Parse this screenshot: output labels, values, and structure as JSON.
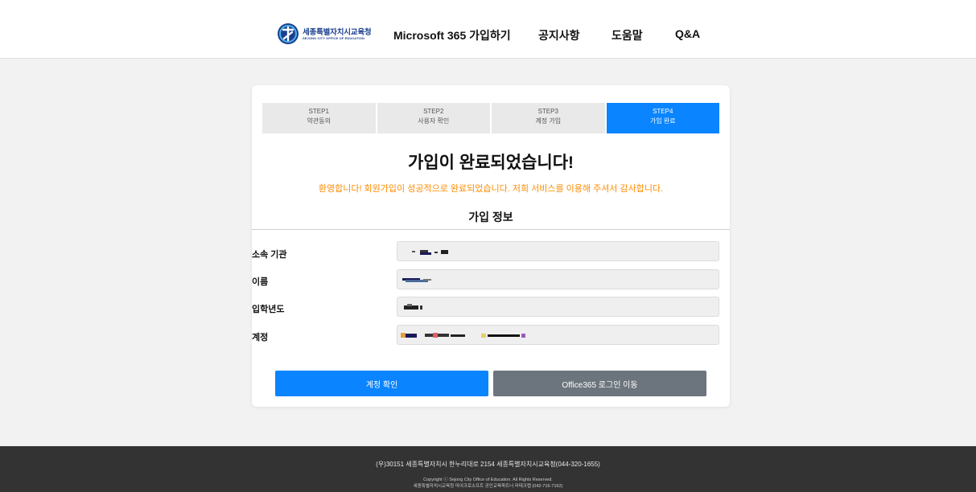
{
  "header": {
    "logo_text": "세종특별자치시교육청",
    "logo_sub": "SEJONG CITY OFFICE OF EDUCATION",
    "nav": [
      {
        "label": "Microsoft 365 가입하기"
      },
      {
        "label": "공지사항"
      },
      {
        "label": "도움말"
      },
      {
        "label": "Q&A"
      }
    ]
  },
  "steps": [
    {
      "num": "STEP1",
      "label": "약관동의",
      "active": false
    },
    {
      "num": "STEP2",
      "label": "사용자 확인",
      "active": false
    },
    {
      "num": "STEP3",
      "label": "계정 가입",
      "active": false
    },
    {
      "num": "STEP4",
      "label": "가입 완료",
      "active": true
    }
  ],
  "main": {
    "title": "가입이 완료되었습니다!",
    "welcome": "환영합니다! 회원가입이 성공적으로 완료되었습니다. 저희 서비스를 이용해 주셔서 감사합니다.",
    "section_title": "가입 정보",
    "fields": [
      {
        "label": "소속 기관",
        "value": "[redacted]"
      },
      {
        "label": "이름",
        "value": "[redacted]"
      },
      {
        "label": "입학년도",
        "value": "[redacted]"
      },
      {
        "label": "계정",
        "value": "[redacted]"
      }
    ],
    "buttons": {
      "check_account": "계정 확인",
      "office_login": "Office365 로그인 이동"
    }
  },
  "footer": {
    "address": "(우)30151 세종특별자치시 한누리대로 2154 세종특별자치시교육청(044-320-1655)",
    "copyright": "Copyright ⓒ Sejong City Office of Education. All Rights Reserved.",
    "partner": "세종특별자치시교육청 마이크로소프트 공인교육파트너 러테크랩 (042-716-7162)"
  },
  "colors": {
    "accent": "#0a84ff",
    "secondary_button": "#6c757d",
    "welcome_text": "#ff8c00",
    "footer_bg": "#333333"
  }
}
